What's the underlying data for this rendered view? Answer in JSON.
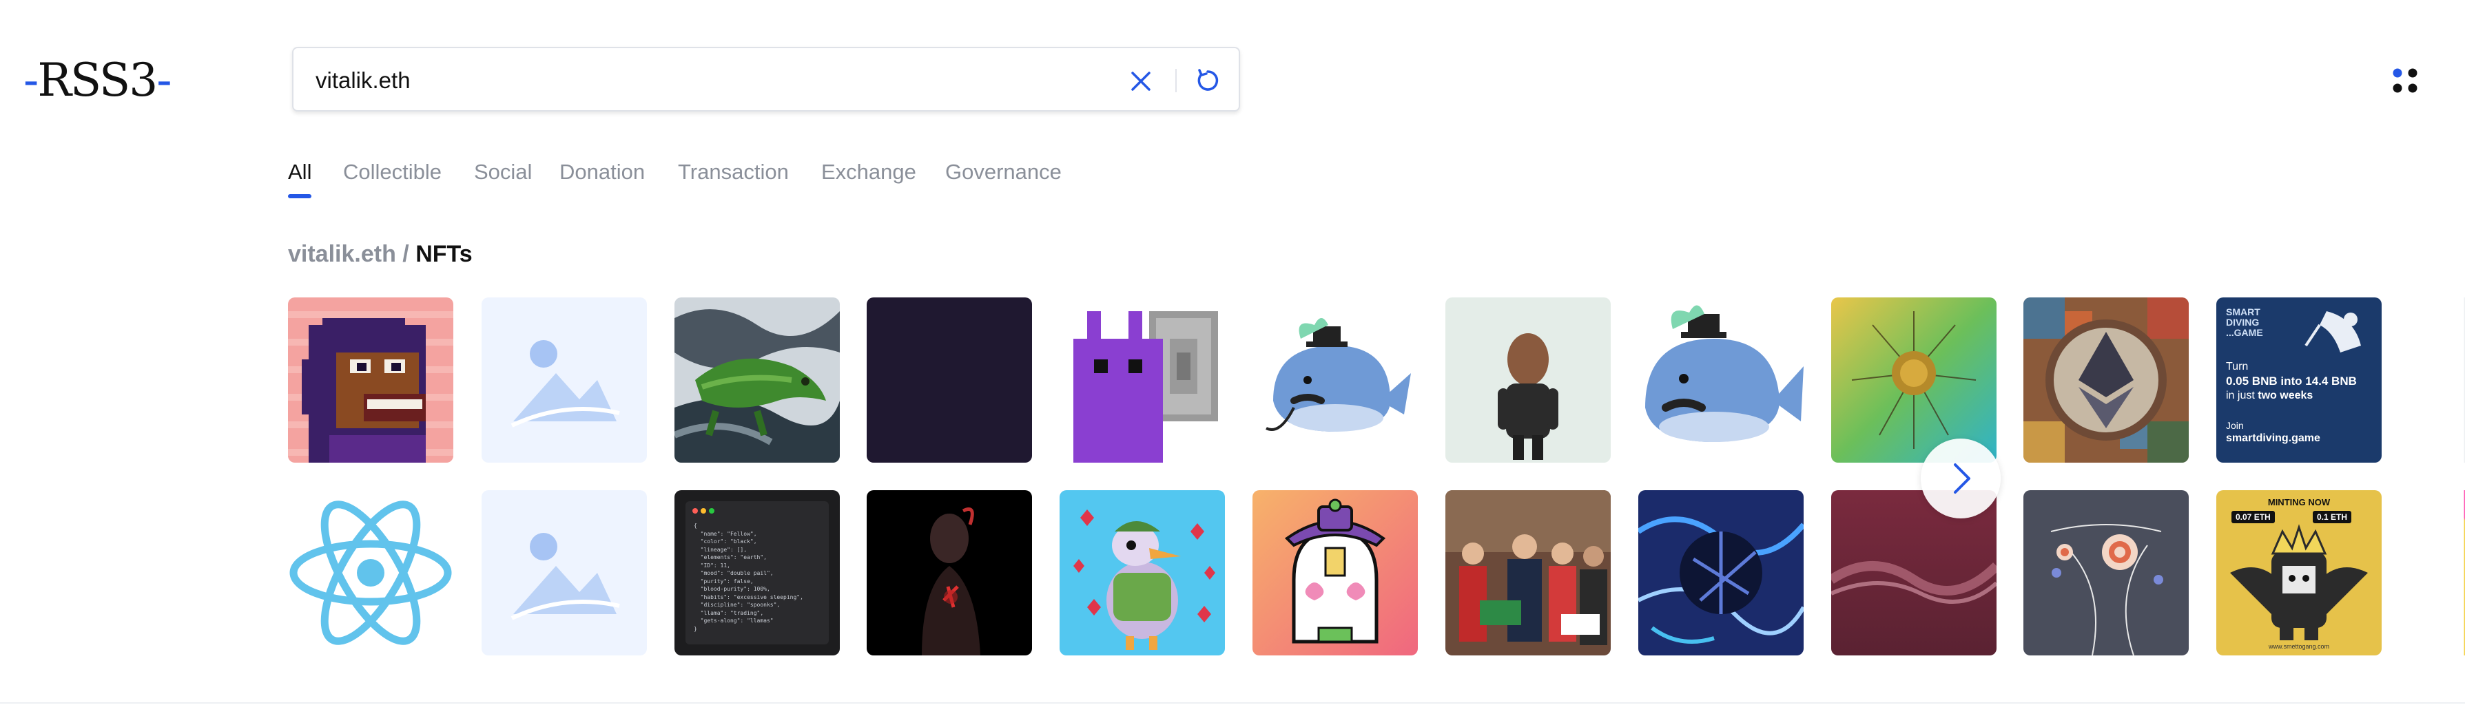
{
  "logo": {
    "text": "RSS3"
  },
  "search": {
    "value": "vitalik.eth",
    "placeholder": ""
  },
  "tabs": [
    {
      "label": "All",
      "active": true
    },
    {
      "label": "Collectible"
    },
    {
      "label": "Social"
    },
    {
      "label": "Donation"
    },
    {
      "label": "Transaction"
    },
    {
      "label": "Exchange"
    },
    {
      "label": "Governance"
    }
  ],
  "breadcrumb": {
    "parent": "vitalik.eth",
    "separator": " / ",
    "current": "NFTs"
  },
  "ad_tile": {
    "brand_line1": "SMART",
    "brand_line2": "DIVING",
    "brand_line3": "...GAME",
    "turn": "Turn",
    "offer_line1": "0.05 BNB into 14.4 BNB",
    "offer_line2_pre": "in just ",
    "offer_line2_bold": "two weeks",
    "join": "Join",
    "site": "smartdiving.game"
  },
  "minting_tile": {
    "header": "MINTING NOW",
    "price_left": "0.07 ETH",
    "price_right": "0.1 ETH",
    "site": "www.smettogang.com"
  },
  "code_tile_lines": [
    "{",
    "  \"name\": \"Fellow\",",
    "  \"color\": \"black\",",
    "  \"lineage\": [],",
    "  \"elements\": \"earth\",",
    "  \"ID\": 11,",
    "  \"mood\": \"double pail\",",
    "  \"purity\": false,",
    "  \"blood-purity\": 100%,",
    "  \"habits\": \"excessive sleeping\",",
    "  \"discipline\": \"spoonks\",",
    "  \"llama\": \"trading\",",
    "  \"gets-along\": \"llamas\"",
    "}"
  ],
  "colors": {
    "accent": "#2457e6",
    "muted": "#8a8f99",
    "text": "#111111"
  }
}
